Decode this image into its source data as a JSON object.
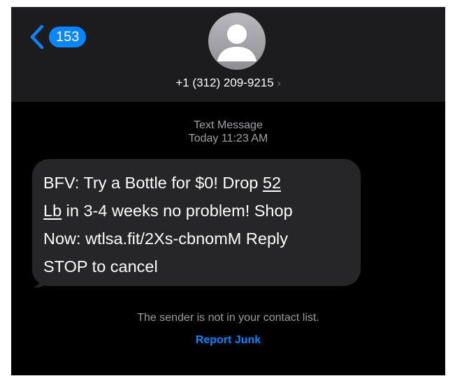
{
  "header": {
    "unread_count": "153",
    "contact_number": "+1 (312) 209-9215",
    "contact_chevron": "›"
  },
  "conversation": {
    "service_label": "Text Message",
    "timestamp": "Today 11:23 AM"
  },
  "message": {
    "line1_a": "BFV: Try a Bottle for $0! Drop ",
    "line1_link": "52",
    "line2_link": "Lb",
    "line2_b": " in 3-4 weeks no problem! Shop",
    "line3": "Now: wtlsa.fit/2Xs-cbnomM Reply",
    "line4": "STOP to cancel"
  },
  "footer": {
    "notice": "The sender is not in your contact list.",
    "report_label": "Report Junk"
  },
  "colors": {
    "accent": "#0a84ff",
    "header_bg": "#1c1c1e",
    "bubble_bg": "#262628",
    "background": "#000000"
  },
  "icons": {
    "back": "chevron-left-icon",
    "avatar": "person-silhouette-icon",
    "contact_detail": "chevron-right-icon"
  }
}
